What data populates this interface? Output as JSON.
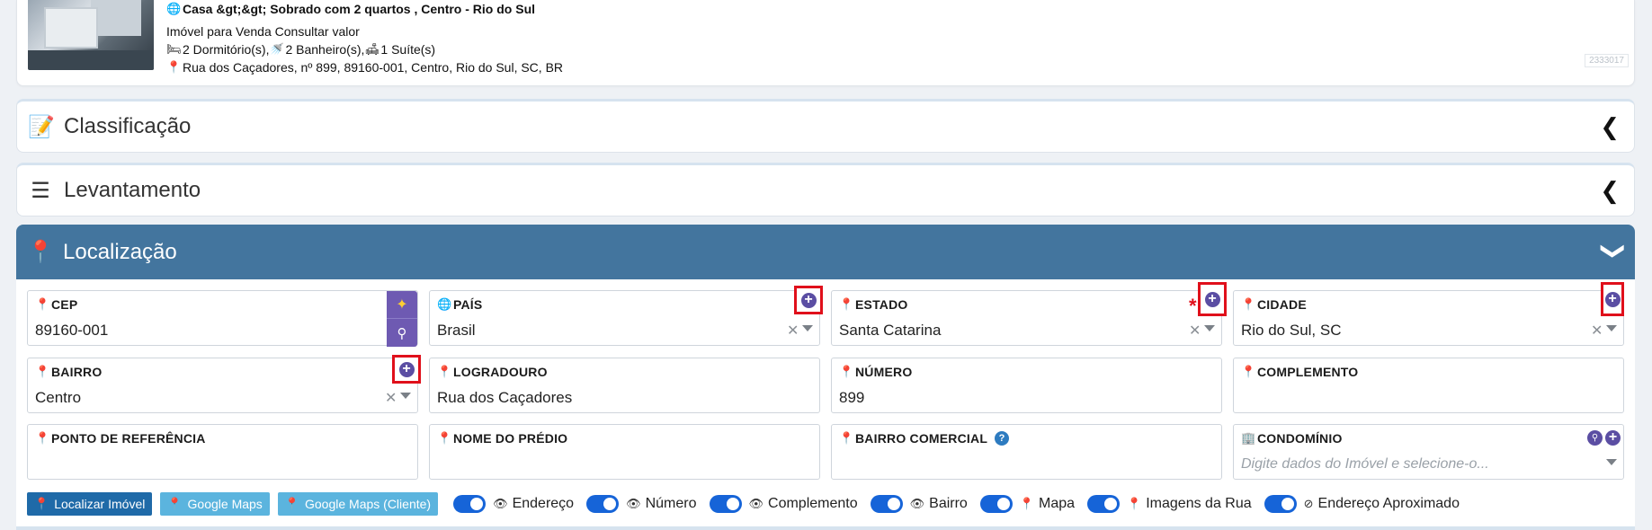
{
  "property": {
    "title": "Casa &gt;&gt; Sobrado com 2 quartos , Centro - Rio do Sul",
    "subtitle": "Imóvel para Venda Consultar valor",
    "rooms": "2 Dormitório(s), 2 Banheiro(s), 1 Suíte(s)",
    "bedrooms": "2 Dormitório(s),",
    "bathrooms": "2 Banheiro(s),",
    "suites": "1 Suíte(s)",
    "address": "Rua dos Caçadores, nº 899, 89160-001, Centro, Rio do Sul, SC, BR",
    "code": "2333017"
  },
  "sections": {
    "classificacao": "Classificação",
    "levantamento": "Levantamento",
    "localizacao": "Localização"
  },
  "fields": {
    "cep": {
      "label": "CEP",
      "value": "89160-001"
    },
    "pais": {
      "label": "PAÍS",
      "value": "Brasil"
    },
    "estado": {
      "label": "ESTADO",
      "value": "Santa Catarina",
      "required_mark": "*"
    },
    "cidade": {
      "label": "CIDADE",
      "value": "Rio do Sul, SC"
    },
    "bairro": {
      "label": "BAIRRO",
      "value": "Centro"
    },
    "logradouro": {
      "label": "LOGRADOURO",
      "value": "Rua dos Caçadores"
    },
    "numero": {
      "label": "NÚMERO",
      "value": "899"
    },
    "complemento": {
      "label": "COMPLEMENTO",
      "value": ""
    },
    "ponto_referencia": {
      "label": "PONTO DE REFERÊNCIA",
      "value": ""
    },
    "nome_predio": {
      "label": "NOME DO PRÉDIO",
      "value": ""
    },
    "bairro_comercial": {
      "label": "BAIRRO COMERCIAL",
      "value": ""
    },
    "condominio": {
      "label": "CONDOMÍNIO",
      "placeholder": "Digite dados do Imóvel e selecione-o..."
    }
  },
  "actions": {
    "localizar": "Localizar Imóvel",
    "google_maps": "Google Maps",
    "google_maps_cliente": "Google Maps (Cliente)"
  },
  "toggles": [
    {
      "label": "Endereço",
      "on": true
    },
    {
      "label": "Número",
      "on": true
    },
    {
      "label": "Complemento",
      "on": true
    },
    {
      "label": "Bairro",
      "on": true
    },
    {
      "label": "Mapa",
      "on": true
    },
    {
      "label": "Imagens da Rua",
      "on": true
    },
    {
      "label": "Endereço Aproximado",
      "on": true
    }
  ],
  "colors": {
    "section_active": "#43759e",
    "toggle_on": "#1664d8",
    "add_button": "#5b4ea3",
    "highlight_box": "#e0101b"
  }
}
